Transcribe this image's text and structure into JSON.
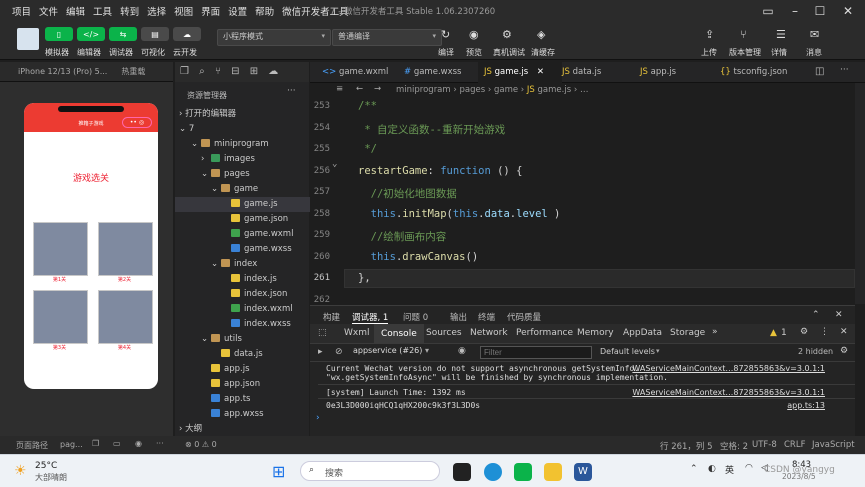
{
  "menu": [
    "项目",
    "文件",
    "编辑",
    "工具",
    "转到",
    "选择",
    "视图",
    "界面",
    "设置",
    "帮助",
    "微信开发者工具"
  ],
  "window_title": "7 - 微信开发者工具 Stable 1.06.2307260",
  "toolbar": {
    "left_buttons": [
      "模拟器",
      "编辑器",
      "调试器",
      "可视化",
      "云开发"
    ],
    "mode_select": "小程序模式",
    "compile_select": "普通编译",
    "center_buttons": [
      "编译",
      "预览",
      "真机调试",
      "清缓存"
    ],
    "right_buttons": [
      "上传",
      "版本管理",
      "详情",
      "消息"
    ]
  },
  "simulator": {
    "device": "iPhone 12/13 (Pro) 5...",
    "hotreload": "热重载",
    "nav_title": "推箱子游戏",
    "page_heading": "游戏选关",
    "levels": [
      "第1关",
      "第2关",
      "第3关",
      "第4关"
    ]
  },
  "explorer": {
    "title": "资源管理器",
    "open_editors": "打开的编辑器",
    "project": "7",
    "outline": "大纲",
    "tree": [
      {
        "label": "miniprogram",
        "indent": 1,
        "kind": "folder"
      },
      {
        "label": "images",
        "indent": 2,
        "kind": "folder-closed"
      },
      {
        "label": "pages",
        "indent": 2,
        "kind": "folder"
      },
      {
        "label": "game",
        "indent": 3,
        "kind": "folder"
      },
      {
        "label": "game.js",
        "indent": 4,
        "kind": "js"
      },
      {
        "label": "game.json",
        "indent": 4,
        "kind": "json"
      },
      {
        "label": "game.wxml",
        "indent": 4,
        "kind": "wxml"
      },
      {
        "label": "game.wxss",
        "indent": 4,
        "kind": "wxss"
      },
      {
        "label": "index",
        "indent": 3,
        "kind": "folder"
      },
      {
        "label": "index.js",
        "indent": 4,
        "kind": "js"
      },
      {
        "label": "index.json",
        "indent": 4,
        "kind": "json"
      },
      {
        "label": "index.wxml",
        "indent": 4,
        "kind": "wxml"
      },
      {
        "label": "index.wxss",
        "indent": 4,
        "kind": "wxss"
      },
      {
        "label": "utils",
        "indent": 2,
        "kind": "folder"
      },
      {
        "label": "data.js",
        "indent": 3,
        "kind": "js"
      },
      {
        "label": "app.js",
        "indent": 2,
        "kind": "js"
      },
      {
        "label": "app.json",
        "indent": 2,
        "kind": "json"
      },
      {
        "label": "app.ts",
        "indent": 2,
        "kind": "ts"
      },
      {
        "label": "app.wxss",
        "indent": 2,
        "kind": "wxss"
      }
    ],
    "selected": "game.js"
  },
  "tabs": [
    "game.wxml",
    "game.wxss",
    "game.js",
    "data.js",
    "app.js",
    "tsconfig.json"
  ],
  "active_tab": "game.js",
  "breadcrumb": [
    "miniprogram",
    "pages",
    "game",
    "game.js"
  ],
  "code_lines": [
    {
      "no": "253",
      "segments": [
        {
          "t": "/**",
          "c": "cm"
        }
      ]
    },
    {
      "no": "254",
      "segments": [
        {
          "t": " * 自定义函数--重新开始游戏",
          "c": "cm"
        }
      ]
    },
    {
      "no": "255",
      "segments": [
        {
          "t": " */",
          "c": "cm"
        }
      ]
    },
    {
      "no": "256",
      "segments": [
        {
          "t": "restartGame",
          "c": "fn"
        },
        {
          "t": ": ",
          "c": "pl"
        },
        {
          "t": "function",
          "c": "kw"
        },
        {
          "t": " () {",
          "c": "pl"
        }
      ]
    },
    {
      "no": "257",
      "segments": [
        {
          "t": "  //初始化地图数据",
          "c": "cm"
        }
      ]
    },
    {
      "no": "258",
      "segments": [
        {
          "t": "  ",
          "c": "pl"
        },
        {
          "t": "this",
          "c": "kw"
        },
        {
          "t": ".",
          "c": "pl"
        },
        {
          "t": "initMap",
          "c": "fn"
        },
        {
          "t": "(",
          "c": "pl"
        },
        {
          "t": "this",
          "c": "kw"
        },
        {
          "t": ".",
          "c": "pl"
        },
        {
          "t": "data",
          "c": "prop"
        },
        {
          "t": ".",
          "c": "pl"
        },
        {
          "t": "level",
          "c": "prop"
        },
        {
          "t": " )",
          "c": "pl"
        }
      ]
    },
    {
      "no": "259",
      "segments": [
        {
          "t": "  //绘制画布内容",
          "c": "cm"
        }
      ]
    },
    {
      "no": "260",
      "segments": [
        {
          "t": "  ",
          "c": "pl"
        },
        {
          "t": "this",
          "c": "kw"
        },
        {
          "t": ".",
          "c": "pl"
        },
        {
          "t": "drawCanvas",
          "c": "fn"
        },
        {
          "t": "()",
          "c": "pl"
        }
      ]
    },
    {
      "no": "261",
      "segments": [
        {
          "t": "},",
          "c": "pl"
        }
      ]
    },
    {
      "no": "262",
      "segments": []
    }
  ],
  "devtools": {
    "top_tabs": [
      "构建",
      "调试器",
      "问题",
      "输出",
      "终端",
      "代码质量"
    ],
    "debugger_badge": "1",
    "problems_badge": "0",
    "panel_tabs": [
      "Wxml",
      "Console",
      "Sources",
      "Network",
      "Performance",
      "Memory",
      "AppData",
      "Storage"
    ],
    "active_panel": "Console",
    "warnings": "1",
    "context": "appservice (#26)",
    "filter_placeholder": "Filter",
    "levels": "Default levels",
    "hidden": "2 hidden",
    "console": [
      {
        "text": "Current Wechat version do not support asynchronous getSystemInfo.\n\"wx.getSystemInfoAsync\" will be finished by synchronous implementation.",
        "src": "WAServiceMainContext…872855863&v=3.0.1:1"
      },
      {
        "text": "[system] Launch Time: 1392 ms",
        "src": "WAServiceMainContext…872855863&v=3.0.1:1"
      },
      {
        "text": "0e3L3D000iqHCQ1qHX200c9k3f3L3D0s",
        "src": "app.ts:13"
      }
    ]
  },
  "statusbar": {
    "left": [
      "页面路径",
      "pag..."
    ],
    "counts": "⊗ 0 ⚠ 0",
    "position": "行 261，列 5",
    "spaces": "空格: 2",
    "encoding": "UTF-8",
    "eol": "CRLF",
    "lang": "JavaScript"
  },
  "taskbar": {
    "temp": "25°C",
    "weather": "大部晴朗",
    "search": "搜索",
    "ime": "英",
    "time": "8:43",
    "date": "2023/8/5",
    "watermark": "CSDN @yangyg"
  },
  "colors": {
    "accent_green": "#0bb34a",
    "nav_red": "#ec3b32"
  }
}
